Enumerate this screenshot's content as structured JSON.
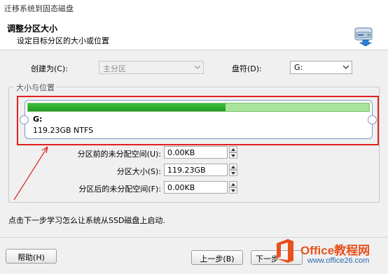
{
  "window": {
    "title": "迁移系统到固态磁盘"
  },
  "header": {
    "title": "调整分区大小",
    "subtitle": "设定目标分区的大小或位置",
    "icon": "disk-wizard-icon"
  },
  "create_as": {
    "label": "创建为(C):",
    "value": "主分区"
  },
  "drive_letter": {
    "label": "盘符(D):",
    "value": "G:"
  },
  "size_group": {
    "title": "大小与位置"
  },
  "partition": {
    "letter": "G:",
    "info": "119.23GB NTFS",
    "fill_fraction": 0.58,
    "colors": {
      "fill": "#2aa52d",
      "free": "#a7e49a",
      "annotation": "#e02020"
    }
  },
  "fields": [
    {
      "label": "分区前的未分配空间(U):",
      "value": "0.00KB"
    },
    {
      "label": "分区大小(S):",
      "value": "119.23GB"
    },
    {
      "label": "分区后的未分配空间(F):",
      "value": "0.00KB"
    }
  ],
  "hint": "点击下一步学习怎么让系统从SSD磁盘上启动.",
  "buttons": {
    "help": "帮助(H)",
    "back": "上一步(B)",
    "next": "下一步"
  },
  "watermark": {
    "brand": "Office教程网",
    "url": "www.office26.com"
  }
}
